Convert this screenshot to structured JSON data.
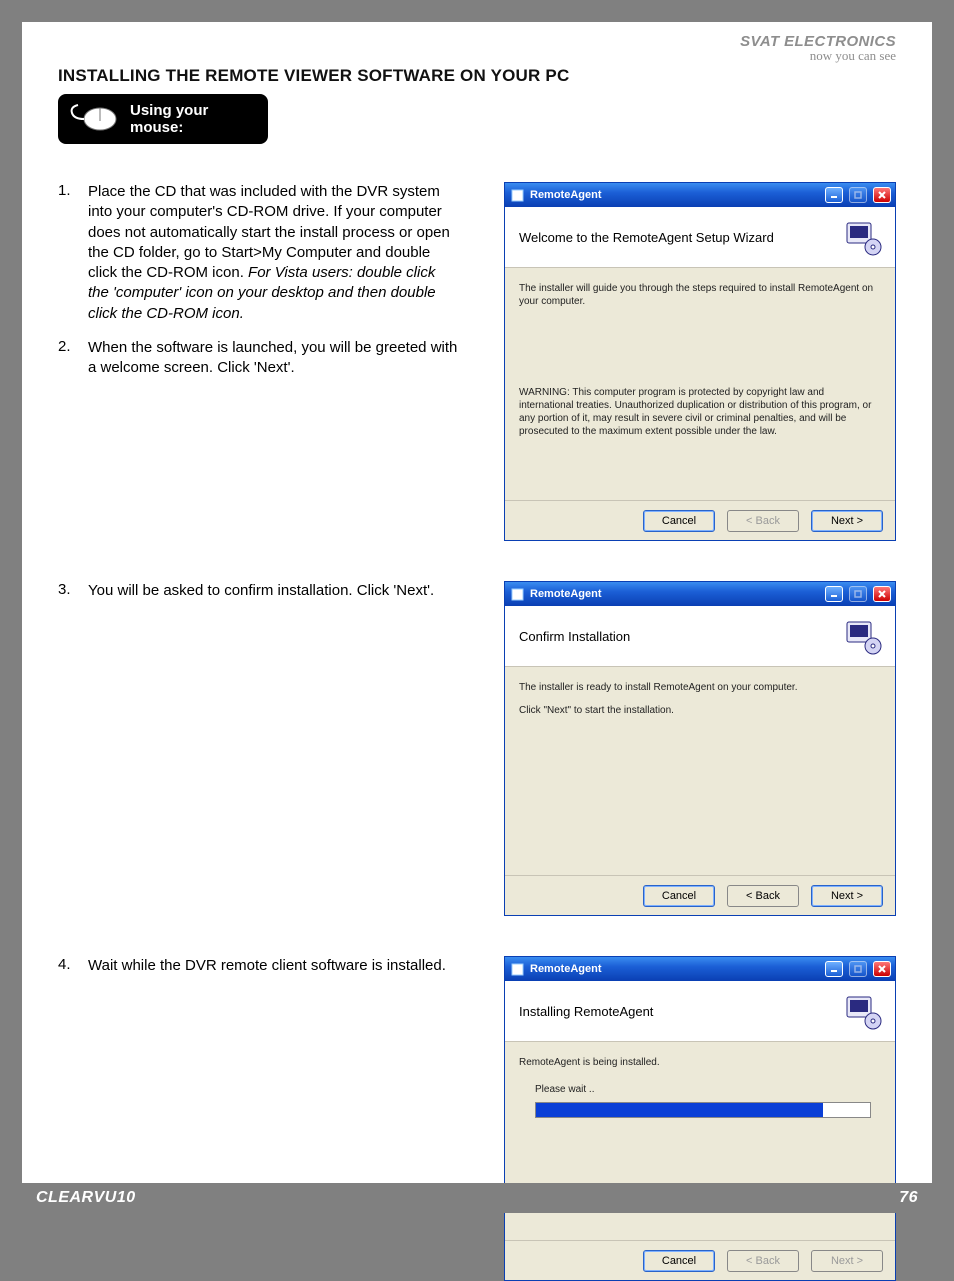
{
  "brand": {
    "name": "SVAT ELECTRONICS",
    "tagline": "now you can see"
  },
  "title": "INSTALLING THE REMOTE VIEWER SOFTWARE ON YOUR PC",
  "mouse_badge": {
    "line1": "Using your",
    "line2": "mouse:"
  },
  "steps": {
    "s1": {
      "num": "1.",
      "text_a": "Place the CD that was included with the DVR system into your computer's CD-ROM drive.  If your computer does not automatically start the install process or open the CD folder, go to Start>My Computer and double click the CD-ROM icon.  ",
      "text_b": "For Vista users: double click the 'computer' icon on your desktop and then double click the CD-ROM icon."
    },
    "s2": {
      "num": "2.",
      "text": "When the software is launched, you will be greeted with a welcome screen.  Click 'Next'."
    },
    "s3": {
      "num": "3.",
      "text": "You will be asked to confirm installation.  Click 'Next'."
    },
    "s4": {
      "num": "4.",
      "text": "Wait while the DVR remote client software is installed."
    }
  },
  "dialogs": {
    "d1": {
      "title": "RemoteAgent",
      "heading": "Welcome to the RemoteAgent Setup Wizard",
      "body": "The installer will guide you through the steps required to install RemoteAgent on your computer.",
      "warning": "WARNING: This computer program is protected by copyright law and international treaties. Unauthorized duplication or distribution of this program, or any portion of it, may result in severe civil or criminal penalties, and will be prosecuted to the maximum extent possible under the law.",
      "buttons": {
        "cancel": "Cancel",
        "back": "< Back",
        "next": "Next >"
      }
    },
    "d2": {
      "title": "RemoteAgent",
      "heading": "Confirm Installation",
      "body1": "The installer is ready to install RemoteAgent on your computer.",
      "body2": "Click \"Next\" to start the installation.",
      "buttons": {
        "cancel": "Cancel",
        "back": "< Back",
        "next": "Next >"
      }
    },
    "d3": {
      "title": "RemoteAgent",
      "heading": "Installing RemoteAgent",
      "body": "RemoteAgent is being installed.",
      "wait": "Please wait ..",
      "buttons": {
        "cancel": "Cancel",
        "back": "< Back",
        "next": "Next >"
      }
    }
  },
  "footer": {
    "left": "CLEARVU10",
    "right": "76"
  }
}
